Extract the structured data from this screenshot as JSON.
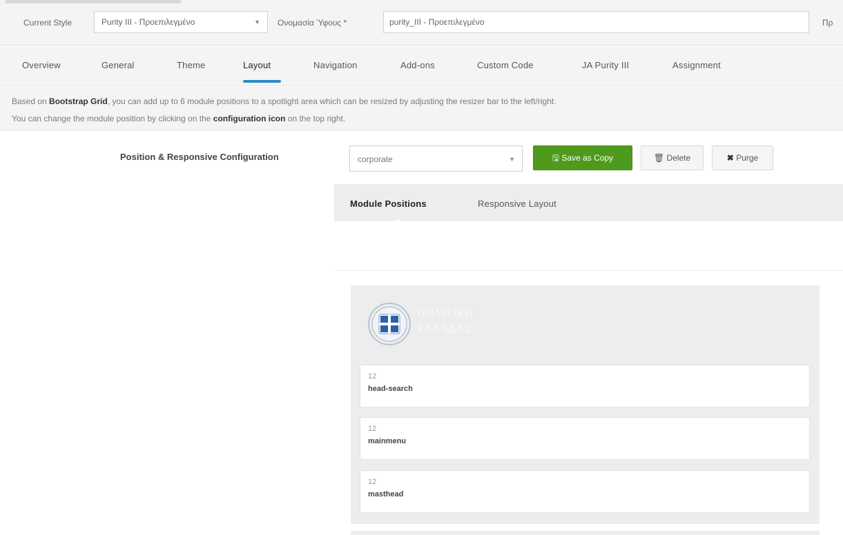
{
  "header": {
    "current_style_label": "Current Style",
    "current_style_value": "Purity III - Προεπιλεγμένο",
    "style_name_label": "Ονομασία Ύφους *",
    "style_name_value": "purity_III - Προεπιλεγμένο",
    "right_cut_label": "Πρ"
  },
  "tabs": [
    {
      "label": "Overview"
    },
    {
      "label": "General"
    },
    {
      "label": "Theme"
    },
    {
      "label": "Layout"
    },
    {
      "label": "Navigation"
    },
    {
      "label": "Add-ons"
    },
    {
      "label": "Custom Code"
    },
    {
      "label": "JA Purity III"
    },
    {
      "label": "Assignment"
    }
  ],
  "active_tab": "Layout",
  "info": {
    "line1_pre": "Based on ",
    "line1_bold": "Bootstrap Grid",
    "line1_post": ", you can add up to 6 module positions to a spotlight area which can be resized by adjusting the resizer bar to the left/right.",
    "line2_pre": "You can change the module position by clicking on the ",
    "line2_bold": "configuration icon",
    "line2_post": " on the top right."
  },
  "config": {
    "label": "Position & Responsive Configuration",
    "layout_select": "corporate",
    "save_copy": "Save as Copy",
    "delete": "Delete",
    "purge": "Purge"
  },
  "subtabs": [
    {
      "label": "Module Positions"
    },
    {
      "label": "Responsive Layout"
    }
  ],
  "logo": {
    "line1": "ΠΟΛΙΤΙΚΗ",
    "line2": "ΕΛΛΑΔΑΣ"
  },
  "blocks": [
    {
      "span": "12",
      "name": "head-search"
    },
    {
      "span": "12",
      "name": "mainmenu"
    },
    {
      "span": "12",
      "name": "masthead"
    }
  ],
  "colors": {
    "accent": "#2c8ac7",
    "save_button": "#4e9a1d",
    "panel": "#ededed"
  }
}
